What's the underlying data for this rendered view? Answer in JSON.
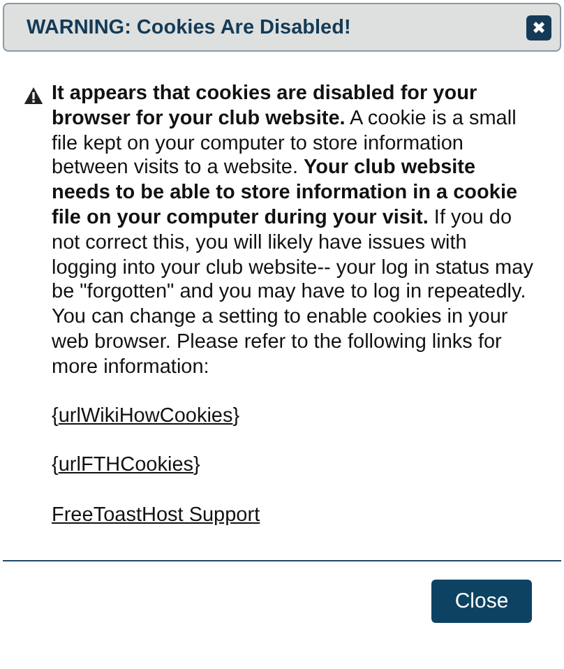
{
  "dialog": {
    "title": "WARNING: Cookies Are Disabled!",
    "close_icon": "✖"
  },
  "message": "**It appears that cookies are disabled for your browser for your club website.** A cookie is a small file kept on your computer to store information between visits to a website. **Your club website needs to be able to store information in a cookie file on your computer during your visit.** If you do not correct this, you will likely have issues with logging into your club website-- your log in status may be \"forgotten\" and you may have to log in repeatedly. You can change a setting to enable cookies in your web browser. Please refer to the following links for more information:",
  "links": [
    {
      "before": "{",
      "label": "urlWikiHowCookies",
      "after": "}"
    },
    {
      "before": "{",
      "label": "urlFTHCookies",
      "after": "}"
    },
    {
      "label": "FreeToastHost Support"
    }
  ],
  "buttons": [
    "Close"
  ]
}
